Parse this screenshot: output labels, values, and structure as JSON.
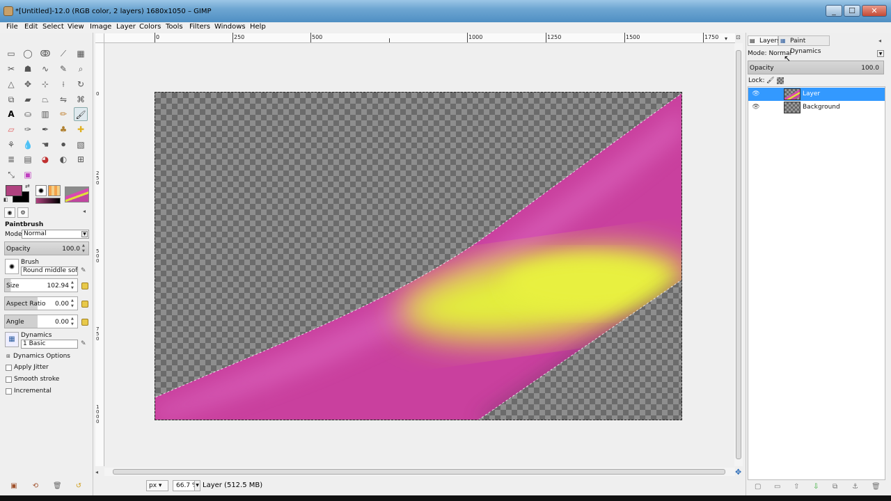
{
  "window": {
    "title": "*[Untitled]-12.0 (RGB color, 2 layers) 1680x1050 – GIMP",
    "minimize": "_",
    "maximize": "☐",
    "close": "✕"
  },
  "menu": [
    "File",
    "Edit",
    "Select",
    "View",
    "Image",
    "Layer",
    "Colors",
    "Tools",
    "Filters",
    "Windows",
    "Help"
  ],
  "ruler": {
    "top_labels": [
      "0",
      "250",
      "500",
      "1000",
      "1250",
      "1500",
      "1750"
    ],
    "left_labels": [
      "0",
      "250",
      "500",
      "750",
      "1000"
    ]
  },
  "tool_options": {
    "title": "Paintbrush",
    "mode_label": "Mode:",
    "mode_value": "Normal",
    "opacity_label": "Opacity",
    "opacity_value": "100.0",
    "brush_label": "Brush",
    "brush_value": "Round  middle soft LS",
    "size_label": "Size",
    "size_value": "102.94",
    "aspect_label": "Aspect Ratio",
    "aspect_value": "0.00",
    "angle_label": "Angle",
    "angle_value": "0.00",
    "dynamics_label": "Dynamics",
    "dynamics_value": "1 Basic",
    "dynamics_options": "Dynamics Options",
    "apply_jitter": "Apply Jitter",
    "smooth_stroke": "Smooth stroke",
    "incremental": "Incremental"
  },
  "colors": {
    "foreground": "#b0427f",
    "background": "#000000",
    "stroke_magenta": "#cc3fa6",
    "stroke_yellow": "#e3ee3c",
    "selected_layer": "#3399ff"
  },
  "status": {
    "unit": "px",
    "zoom": "66.7 %",
    "text": "Layer (512.5 MB)"
  },
  "dock": {
    "tabs": [
      "Layers",
      "Paint Dynamics"
    ],
    "mode_label": "Mode:",
    "mode_value": "Normal",
    "opacity_label": "Opacity",
    "opacity_value": "100.0",
    "lock_label": "Lock:",
    "layers": [
      {
        "name": "Layer",
        "selected": true
      },
      {
        "name": "Background",
        "selected": false
      }
    ]
  }
}
